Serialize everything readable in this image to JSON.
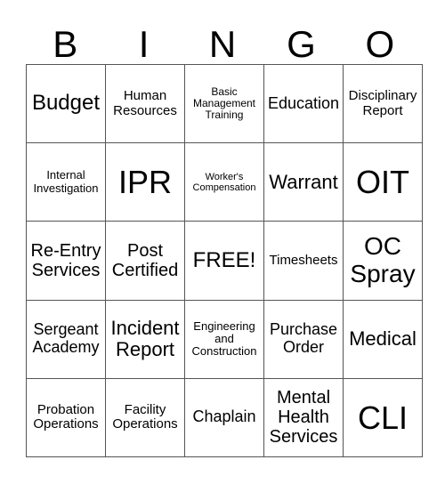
{
  "header": {
    "letters": [
      "B",
      "I",
      "N",
      "G",
      "O"
    ]
  },
  "cells": [
    [
      "Budget",
      "Human Resources",
      "Basic Management Training",
      "Education",
      "Disciplinary Report"
    ],
    [
      "Internal Investigation",
      "IPR",
      "Worker's Compensation",
      "Warrant",
      "OIT"
    ],
    [
      "Re-Entry Services",
      "Post Certified",
      "FREE!",
      "Timesheets",
      "OC Spray"
    ],
    [
      "Sergeant Academy",
      "Incident Report",
      "Engineering and Construction",
      "Purchase Order",
      "Medical"
    ],
    [
      "Probation Operations",
      "Facility Operations",
      "Chaplain",
      "Mental Health Services",
      "CLI"
    ]
  ]
}
